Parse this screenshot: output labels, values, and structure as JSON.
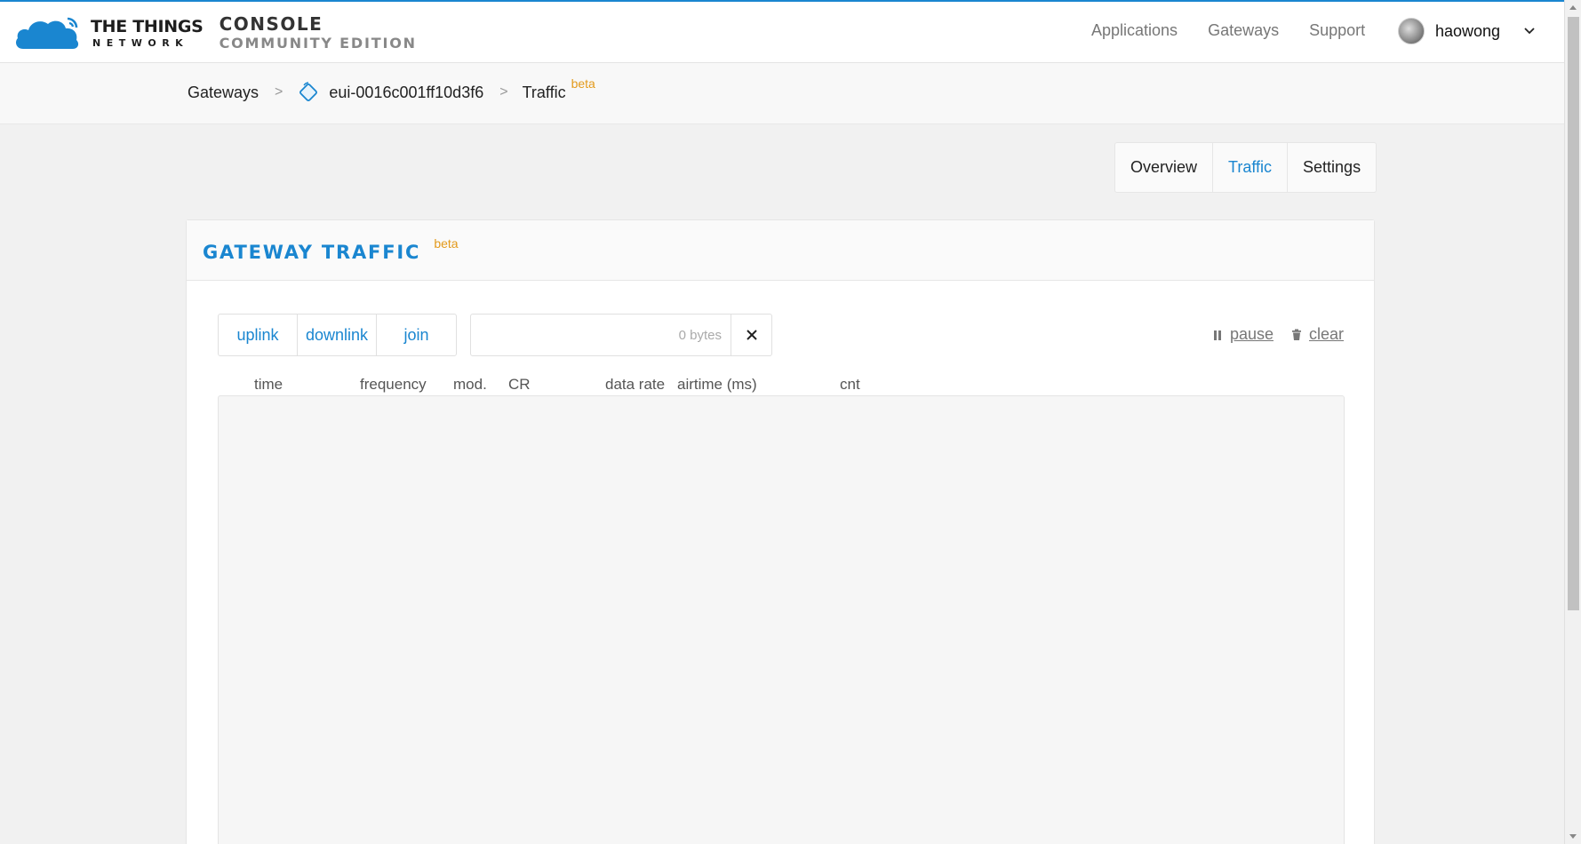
{
  "header": {
    "logo": {
      "ttn_line1": "THE THINGS",
      "ttn_line2": "NETWORK",
      "console_line1": "CONSOLE",
      "console_line2": "COMMUNITY EDITION"
    },
    "nav": [
      "Applications",
      "Gateways",
      "Support"
    ],
    "user": {
      "name": "haowong"
    }
  },
  "breadcrumb": {
    "items": [
      "Gateways",
      "eui-0016c001ff10d3f6",
      "Traffic"
    ],
    "badge": "beta"
  },
  "tabs": {
    "items": [
      "Overview",
      "Traffic",
      "Settings"
    ],
    "active": "Traffic"
  },
  "card": {
    "title": "GATEWAY TRAFFIC",
    "badge": "beta",
    "filters": [
      "uplink",
      "downlink",
      "join"
    ],
    "search": {
      "value": "",
      "placeholder": "0 bytes"
    },
    "actions": {
      "pause": "pause",
      "clear": "clear"
    },
    "columns": [
      "time",
      "frequency",
      "mod.",
      "CR",
      "data rate",
      "airtime (ms)",
      "cnt"
    ]
  },
  "colors": {
    "accent": "#1a86d0",
    "beta": "#e39a1c"
  }
}
